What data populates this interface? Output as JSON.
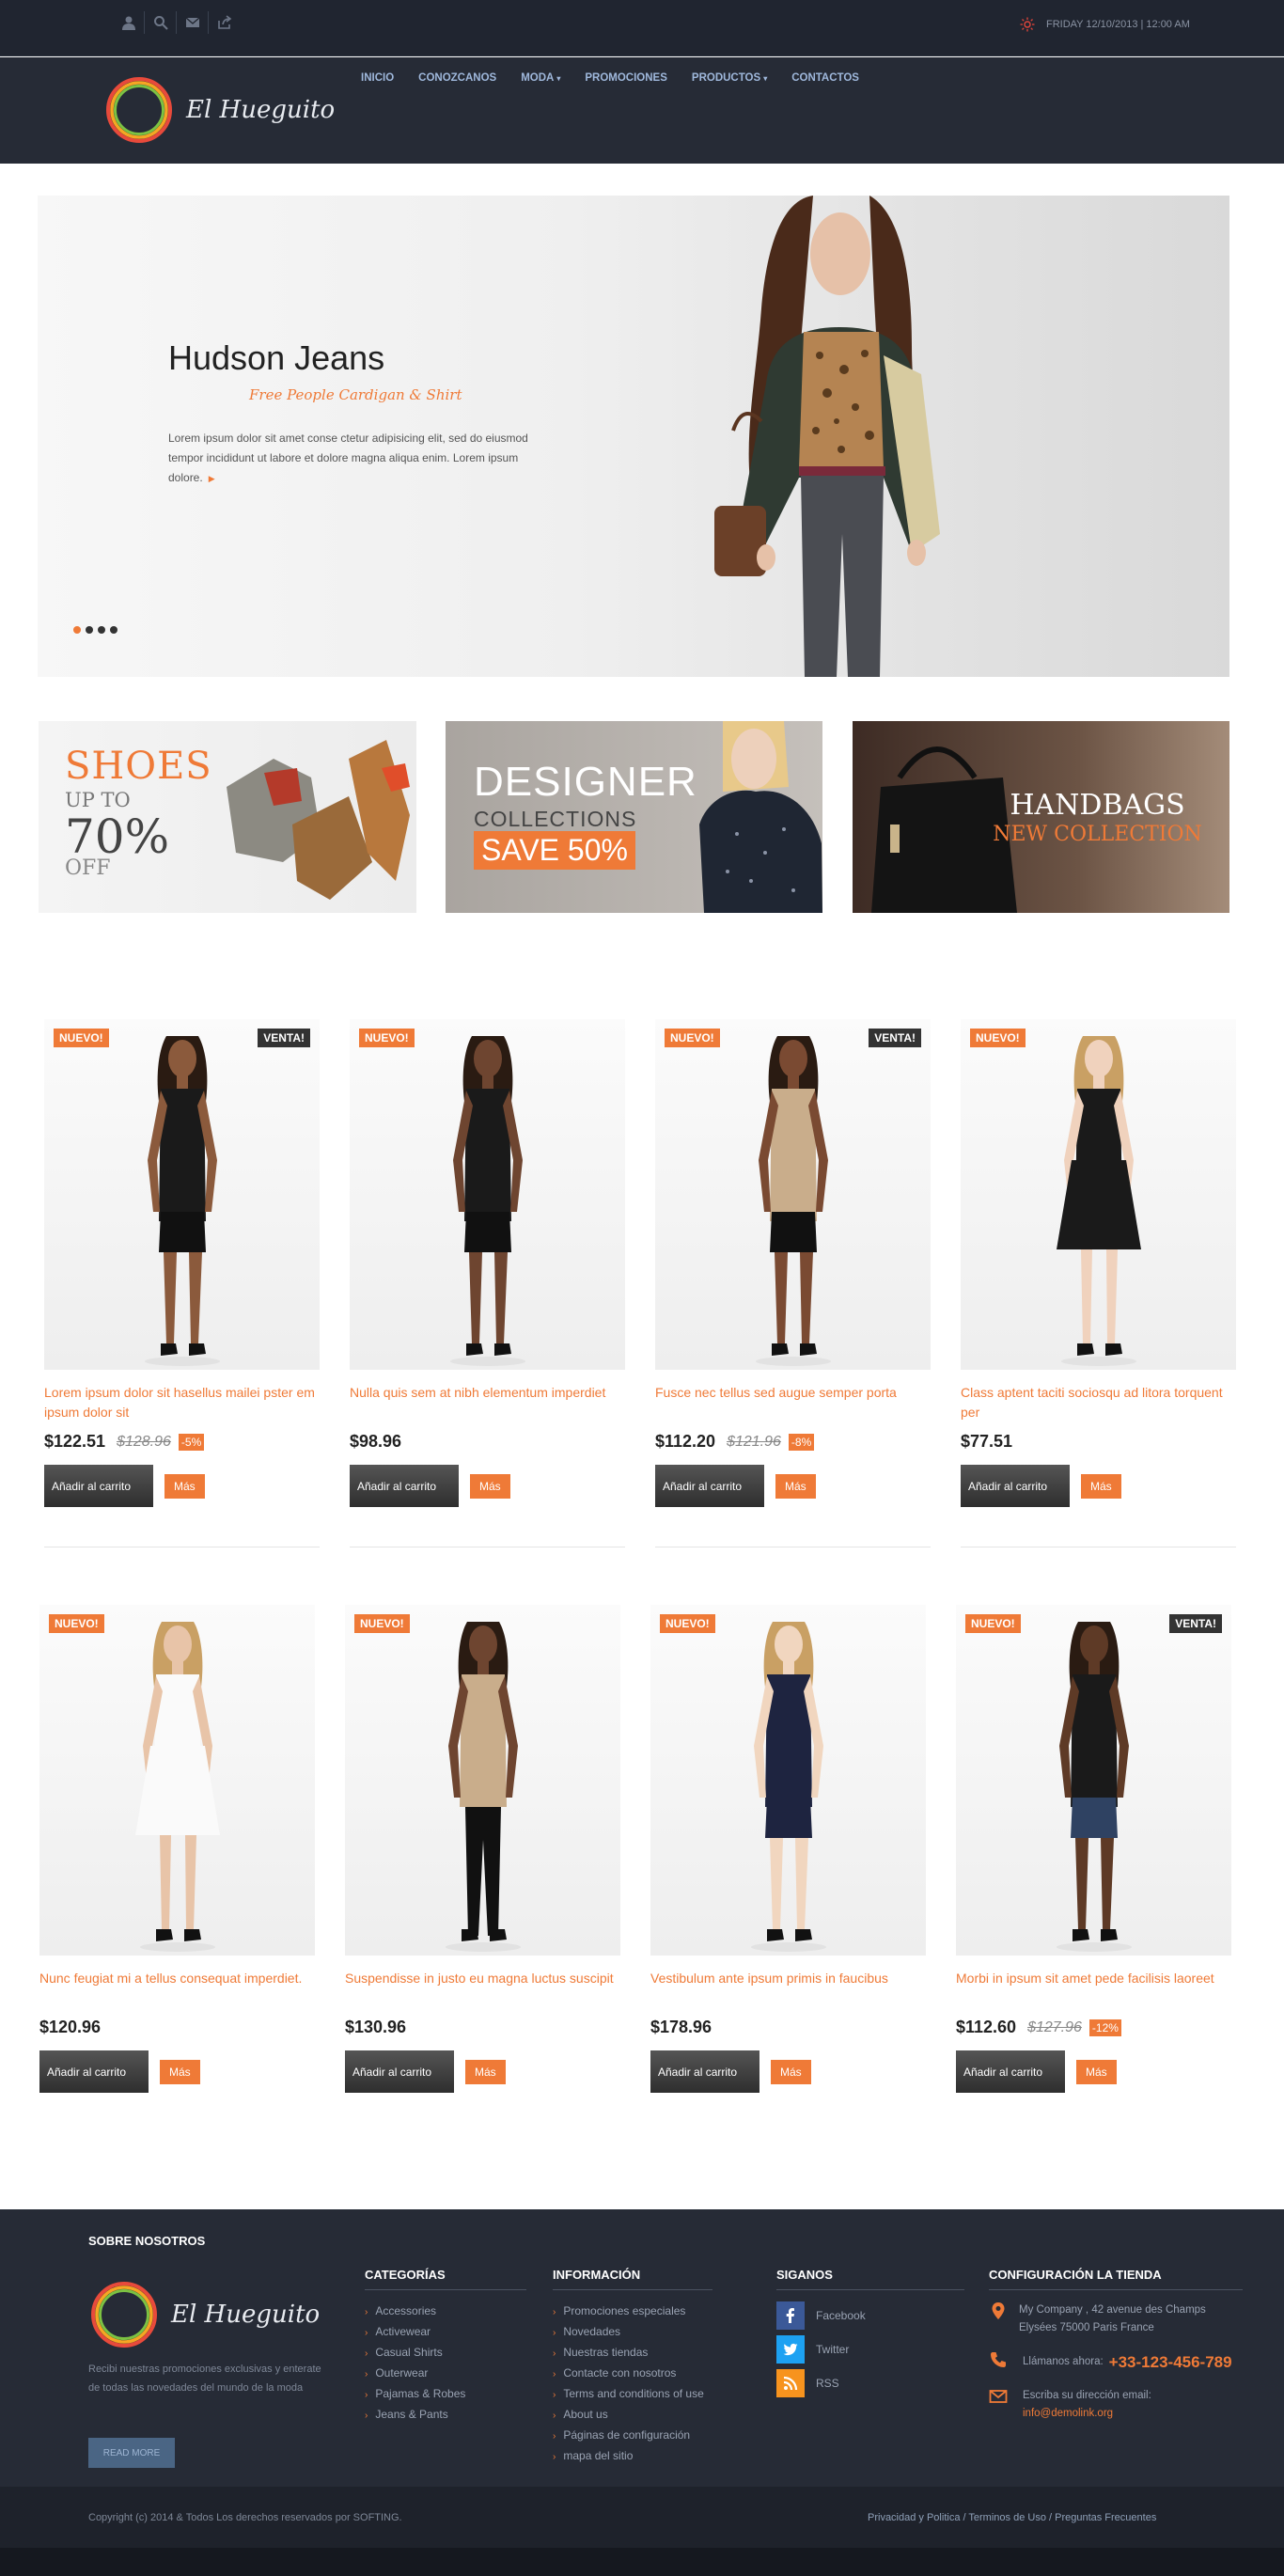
{
  "topbar": {
    "icons": [
      "user-icon",
      "search-icon",
      "mail-icon",
      "share-icon"
    ],
    "date": "FRIDAY 12/10/2013 | 12:00 AM"
  },
  "header": {
    "logo_text": "El Hueguito",
    "nav": [
      {
        "label": "INICIO",
        "dropdown": false
      },
      {
        "label": "CONOZCANOS",
        "dropdown": false
      },
      {
        "label": "MODA",
        "dropdown": true
      },
      {
        "label": "PROMOCIONES",
        "dropdown": false
      },
      {
        "label": "PRODUCTOS",
        "dropdown": true
      },
      {
        "label": "CONTACTOS",
        "dropdown": false
      }
    ]
  },
  "hero": {
    "title": "Hudson Jeans",
    "subtitle": "Free People Cardigan & Shirt",
    "body": "Lorem ipsum dolor sit amet conse ctetur adipisicing elit, sed do eiusmod tempor incididunt ut labore et dolore magna aliqua enim. Lorem ipsum dolore.",
    "slides": 4,
    "active_slide": 1
  },
  "banners": {
    "shoes": {
      "line1": "SHOES",
      "line2": "UP TO",
      "line3": "70%",
      "line4": "OFF"
    },
    "designer": {
      "line1": "DESIGNER",
      "line2": "COLLECTIONS",
      "line3": "SAVE 50%"
    },
    "handbags": {
      "line1": "HANDBAGS",
      "line2": "NEW COLLECTION"
    }
  },
  "labels": {
    "new_badge": "NUEVO!",
    "sale_badge": "VENTA!",
    "add_to_cart": "Añadir al carrito",
    "more": "Más"
  },
  "products": [
    {
      "name": "Lorem ipsum dolor sit hasellus mailei pster em ipsum dolor sit",
      "price": "$122.51",
      "old_price": "$128.96",
      "discount": "-5%",
      "new": true,
      "sale": true,
      "outfit": "black",
      "bottom": "black"
    },
    {
      "name": "Nulla quis sem at nibh elementum imperdiet",
      "price": "$98.96",
      "old_price": "",
      "discount": "",
      "new": true,
      "sale": false,
      "outfit": "black",
      "bottom": "black"
    },
    {
      "name": "Fusce nec tellus sed augue semper porta",
      "price": "$112.20",
      "old_price": "$121.96",
      "discount": "-8%",
      "new": true,
      "sale": true,
      "outfit": "beige",
      "bottom": "black"
    },
    {
      "name": "Class aptent taciti sociosqu ad litora torquent per",
      "price": "$77.51",
      "old_price": "",
      "discount": "",
      "new": true,
      "sale": false,
      "outfit": "black",
      "bottom": "dress"
    },
    {
      "name": "Nunc feugiat mi a tellus consequat imperdiet.",
      "price": "$120.96",
      "old_price": "",
      "discount": "",
      "new": true,
      "sale": false,
      "outfit": "white",
      "bottom": "dress"
    },
    {
      "name": "Suspendisse in justo eu magna luctus suscipit",
      "price": "$130.96",
      "old_price": "",
      "discount": "",
      "new": true,
      "sale": false,
      "outfit": "beige",
      "bottom": "long"
    },
    {
      "name": "Vestibulum ante ipsum primis in faucibus",
      "price": "$178.96",
      "old_price": "",
      "discount": "",
      "new": true,
      "sale": false,
      "outfit": "navy",
      "bottom": "navy"
    },
    {
      "name": "Morbi in ipsum sit amet pede facilisis laoreet",
      "price": "$112.60",
      "old_price": "$127.96",
      "discount": "-12%",
      "new": true,
      "sale": true,
      "outfit": "black",
      "bottom": "denim"
    }
  ],
  "footer": {
    "about_title": "SOBRE NOSOTROS",
    "logo_text": "El Hueguito",
    "about_text": "Recibi nuestras promociones exclusivas y enterate de todas las novedades del mundo de la moda",
    "read_more": "READ MORE",
    "categories_title": "CATEGORÍAS",
    "categories": [
      "Accessories",
      "Activewear",
      "Casual Shirts",
      "Outerwear",
      "Pajamas & Robes",
      "Jeans & Pants"
    ],
    "info_title": "INFORMACIÓN",
    "info": [
      "Promociones especiales",
      "Novedades",
      "Nuestras tiendas",
      "Contacte con nosotros",
      "Terms and conditions of use",
      "About us",
      "Páginas de configuración",
      "mapa del sitio"
    ],
    "follow_title": "SIGANOS",
    "social": [
      {
        "label": "Facebook",
        "icon": "facebook-icon",
        "color": "#3b5998"
      },
      {
        "label": "Twitter",
        "icon": "twitter-icon",
        "color": "#1da1f2"
      },
      {
        "label": "RSS",
        "icon": "rss-icon",
        "color": "#f7931e"
      }
    ],
    "store_title": "CONFIGURACIÓN LA TIENDA",
    "address": "My Company , 42 avenue des Champs Elysées 75000 Paris France",
    "call_label": "Llámanos ahora:",
    "phone": "+33-123-456-789",
    "email_label": "Escriba su dirección email:",
    "email": "info@demolink.org",
    "copyright": "Copyright (c) 2014 & Todos Los derechos reservados por SOFTING.",
    "bottom_links": "Privacidad y Politica / Terminos de Uso / Preguntas Frecuentes"
  },
  "colors": {
    "accent": "#ef7a37",
    "header_bg": "#262b36",
    "topbar_bg": "#202530"
  }
}
